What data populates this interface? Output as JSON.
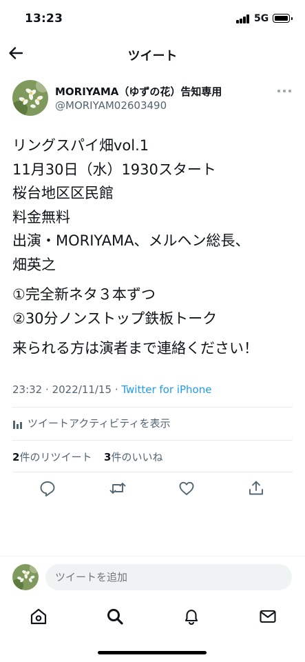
{
  "status_bar": {
    "time": "13:23",
    "network": "5G"
  },
  "header": {
    "title": "ツイート"
  },
  "author": {
    "name": "MORIYAMA（ゆずの花）告知専用",
    "handle": "@MORIYAM02603490"
  },
  "tweet": {
    "lines_1": [
      "リングスパイ畑vol.1",
      "11月30日（水）1930スタート",
      "桜台地区区民館",
      "料金無料",
      "出演・MORIYAMA、メルヘン総長、",
      "畑英之"
    ],
    "lines_2": [
      "①完全新ネタ３本ずつ",
      "②30分ノンストップ鉄板トーク"
    ],
    "lines_3": [
      "来られる方は演者まで連絡ください！"
    ],
    "time": "23:32",
    "date": "2022/11/15",
    "source": "Twitter for iPhone"
  },
  "activity": {
    "label": "ツイートアクティビティを表示"
  },
  "stats": {
    "retweets_count": "2",
    "retweets_label": "件のリツイート",
    "likes_count": "3",
    "likes_label": "件のいいね"
  },
  "actions": [
    "reply-icon",
    "retweet-icon",
    "like-icon",
    "share-icon"
  ],
  "reply_bar": {
    "placeholder": "ツイートを追加"
  },
  "tabbar": [
    "home-icon",
    "search-icon",
    "notifications-icon",
    "messages-icon"
  ],
  "colors": {
    "accent": "#1d9bf0",
    "secondary_text": "#536471",
    "primary_text": "#0f1419"
  }
}
